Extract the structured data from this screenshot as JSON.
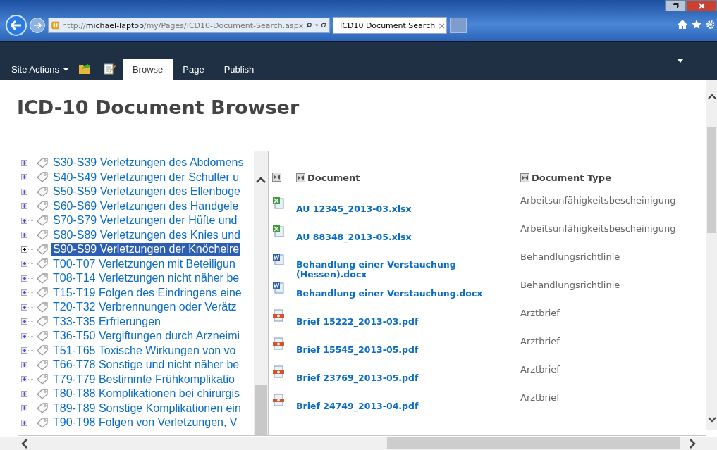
{
  "browser": {
    "url": "http://**michael-laptop**/my/Pages/ICD10-Document-Search.aspx",
    "tab": {
      "title": "ICD10 Document Search",
      "close": "×"
    }
  },
  "ribbon": {
    "site_actions": "Site Actions",
    "tabs": [
      {
        "label": "Browse",
        "selected": true
      },
      {
        "label": "Page",
        "selected": false
      },
      {
        "label": "Publish",
        "selected": false
      }
    ]
  },
  "page_title": "ICD-10 Document Browser",
  "tree": {
    "items": [
      {
        "label": "S30-S39 Verletzungen des Abdomens",
        "selected": false
      },
      {
        "label": "S40-S49 Verletzungen der Schulter u",
        "selected": false
      },
      {
        "label": "S50-S59 Verletzungen des Ellenboge",
        "selected": false
      },
      {
        "label": "S60-S69 Verletzungen des Handgele",
        "selected": false
      },
      {
        "label": "S70-S79 Verletzungen der Hüfte und",
        "selected": false
      },
      {
        "label": "S80-S89 Verletzungen des Knies und",
        "selected": false
      },
      {
        "label": "S90-S99 Verletzungen der Knöchelre",
        "selected": true
      },
      {
        "label": "T00-T07 Verletzungen mit Beteiligun",
        "selected": false
      },
      {
        "label": "T08-T14 Verletzungen nicht näher be",
        "selected": false
      },
      {
        "label": "T15-T19 Folgen des Eindringens eine",
        "selected": false
      },
      {
        "label": "T20-T32 Verbrennungen oder Verätz",
        "selected": false
      },
      {
        "label": "T33-T35 Erfrierungen",
        "selected": false
      },
      {
        "label": "T36-T50 Vergiftungen durch Arzneimi",
        "selected": false
      },
      {
        "label": "T51-T65 Toxische Wirkungen von vo",
        "selected": false
      },
      {
        "label": "T66-T78 Sonstige und nicht näher be",
        "selected": false
      },
      {
        "label": "T79-T79 Bestimmte Frühkomplikatio",
        "selected": false
      },
      {
        "label": "T80-T88 Komplikationen bei chirurgis",
        "selected": false
      },
      {
        "label": "T89-T89 Sonstige Komplikationen ein",
        "selected": false
      },
      {
        "label": "T90-T98 Folgen von Verletzungen, V",
        "selected": false
      }
    ]
  },
  "documents": {
    "columns": [
      "Document",
      "Document Type"
    ],
    "rows": [
      {
        "kind": "xlsx",
        "name": "AU 12345_2013-03.xlsx",
        "type": "Arbeitsunfähigkeitsbescheinigung"
      },
      {
        "kind": "xlsx",
        "name": "AU 88348_2013-05.xlsx",
        "type": "Arbeitsunfähigkeitsbescheinigung"
      },
      {
        "kind": "docx",
        "name": "Behandlung einer Verstauchung (Hessen).docx",
        "type": "Behandlungsrichtlinie"
      },
      {
        "kind": "docx",
        "name": "Behandlung einer Verstauchung.docx",
        "type": "Behandlungsrichtlinie"
      },
      {
        "kind": "pdf",
        "name": "Brief 15222_2013-03.pdf",
        "type": "Arztbrief"
      },
      {
        "kind": "pdf",
        "name": "Brief 15545_2013-05.pdf",
        "type": "Arztbrief"
      },
      {
        "kind": "pdf",
        "name": "Brief 23769_2013-05.pdf",
        "type": "Arztbrief"
      },
      {
        "kind": "pdf",
        "name": "Brief 24749_2013-04.pdf",
        "type": "Arztbrief"
      }
    ]
  }
}
